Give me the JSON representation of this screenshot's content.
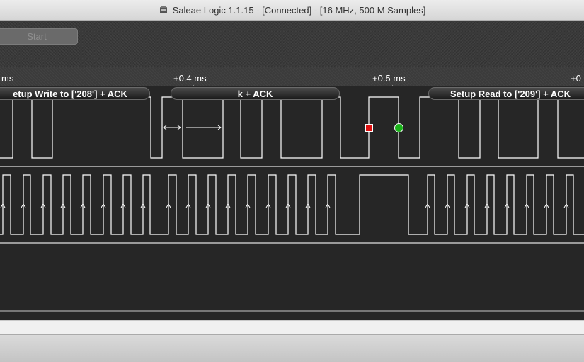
{
  "window": {
    "title": "Saleae Logic 1.1.15 - [Connected] - [16 MHz, 500 M Samples]"
  },
  "toolbar": {
    "start_label": "Start"
  },
  "ruler": {
    "labels": [
      "ms",
      "+0.4 ms",
      "+0.5 ms",
      "+0"
    ]
  },
  "decoded": {
    "packets": [
      "etup Write to ['208'] + ACK",
      "k + ACK",
      "Setup Read to ['209'] + ACK"
    ]
  },
  "colors": {
    "trace": "#ffffff",
    "background": "#262626",
    "marker_red": "#dd1111",
    "marker_green": "#19b319"
  },
  "icons": {
    "app": "saleae-logic-app-icon",
    "measure": "double-arrow-icon",
    "cursor_red": "red-square-marker-icon",
    "cursor_green": "green-circle-marker-icon"
  }
}
